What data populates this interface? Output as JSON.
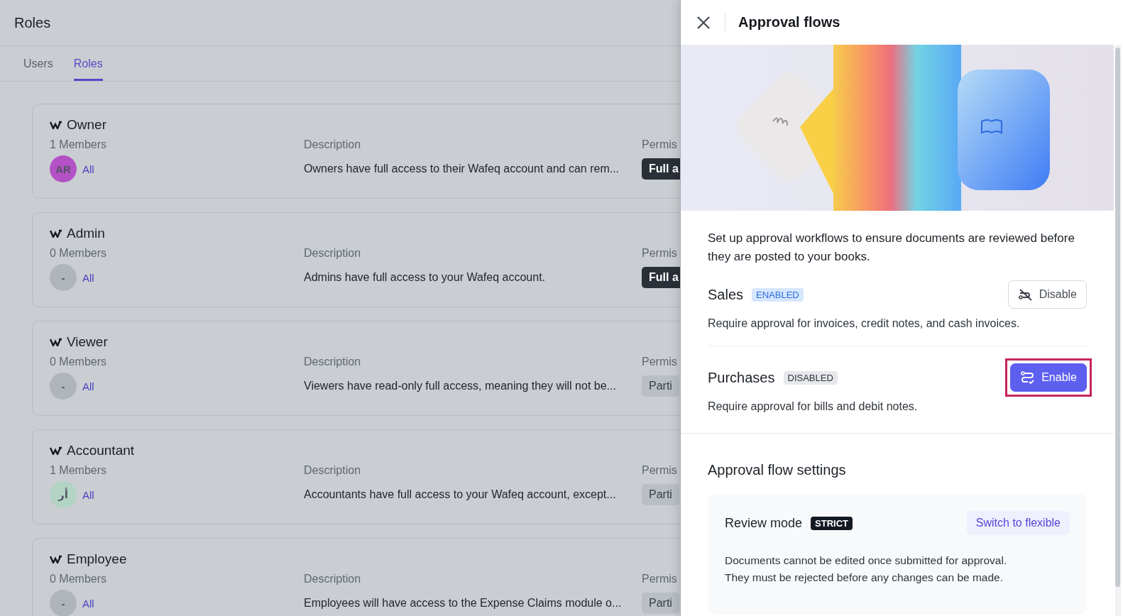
{
  "page": {
    "title": "Roles"
  },
  "tabs": [
    {
      "label": "Users",
      "selected": false
    },
    {
      "label": "Roles",
      "selected": true
    }
  ],
  "roles": [
    {
      "name": "Owner",
      "members": "1 Members",
      "avatar": {
        "text": "AR",
        "color": "#b451c6"
      },
      "members_link": "All",
      "description_label": "Description",
      "description": "Owners have full access to their Wafeq account and can rem...",
      "permissions_label": "Permis",
      "permission": {
        "text": "Full a",
        "kind": "full"
      }
    },
    {
      "name": "Admin",
      "members": "0 Members",
      "avatar": {
        "text": "-",
        "color": "#b0b5bb"
      },
      "members_link": "All",
      "description_label": "Description",
      "description": "Admins have full access to your Wafeq account.",
      "permissions_label": "Permis",
      "permission": {
        "text": "Full a",
        "kind": "full"
      }
    },
    {
      "name": "Viewer",
      "members": "0 Members",
      "avatar": {
        "text": "-",
        "color": "#b0b5bb"
      },
      "members_link": "All",
      "description_label": "Description",
      "description": "Viewers have read-only full access, meaning they will not be...",
      "permissions_label": "Permis",
      "permission": {
        "text": "Parti",
        "kind": "partial"
      }
    },
    {
      "name": "Accountant",
      "members": "1 Members",
      "avatar": {
        "text": "أر",
        "color": "#b3d4c4"
      },
      "members_link": "All",
      "description_label": "Description",
      "description": "Accountants have full access to your Wafeq account, except...",
      "permissions_label": "Permis",
      "permission": {
        "text": "Parti",
        "kind": "partial"
      }
    },
    {
      "name": "Employee",
      "members": "0 Members",
      "avatar": {
        "text": "-",
        "color": "#b0b5bb"
      },
      "members_link": "All",
      "description_label": "Description",
      "description": "Employees will have access to the Expense Claims module o...",
      "permissions_label": "Permis",
      "permission": {
        "text": "Parti",
        "kind": "partial"
      }
    }
  ],
  "drawer": {
    "title": "Approval flows",
    "intro": "Set up approval workflows to ensure documents are reviewed before they are posted to your books.",
    "flows": [
      {
        "name": "Sales",
        "status": "ENABLED",
        "enabled": true,
        "description": "Require approval for invoices, credit notes, and cash invoices.",
        "action": "Disable",
        "highlighted": false
      },
      {
        "name": "Purchases",
        "status": "DISABLED",
        "enabled": false,
        "description": "Require approval for bills and debit notes.",
        "action": "Enable",
        "highlighted": true
      }
    ],
    "settings": {
      "title": "Approval flow settings",
      "mode_label": "Review mode",
      "mode": "STRICT",
      "switch": "Switch to flexible",
      "description": "Documents cannot be edited once submitted for approval.\nThey must be rejected before any changes can be made."
    }
  }
}
